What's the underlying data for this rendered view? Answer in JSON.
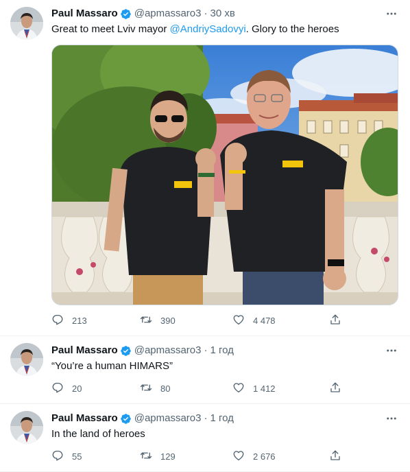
{
  "tweets": [
    {
      "author_name": "Paul Massaro",
      "handle": "@apmassaro3",
      "separator": "·",
      "time": "30 хв",
      "text_before": "Great to meet Lviv mayor ",
      "mention": "@AndriySadovyi",
      "text_after": ". Glory to the heroes",
      "replies": "213",
      "retweets": "390",
      "likes": "4 478"
    },
    {
      "author_name": "Paul Massaro",
      "handle": "@apmassaro3",
      "separator": "·",
      "time": "1 год",
      "text": "“You’re a human HIMARS”",
      "replies": "20",
      "retweets": "80",
      "likes": "1 412"
    },
    {
      "author_name": "Paul Massaro",
      "handle": "@apmassaro3",
      "separator": "·",
      "time": "1 год",
      "text": "In the land of heroes",
      "replies": "55",
      "retweets": "129",
      "likes": "2 676"
    }
  ],
  "icons": {
    "verified": "verified-badge-icon",
    "more": "more-dots-icon",
    "reply": "reply-bubble-icon",
    "retweet": "retweet-arrows-icon",
    "like": "heart-icon",
    "share": "share-upload-icon"
  },
  "colors": {
    "brand_blue": "#1d9bf0",
    "text_primary": "#0f1419",
    "text_secondary": "#536471",
    "divider": "#eff3f4"
  }
}
